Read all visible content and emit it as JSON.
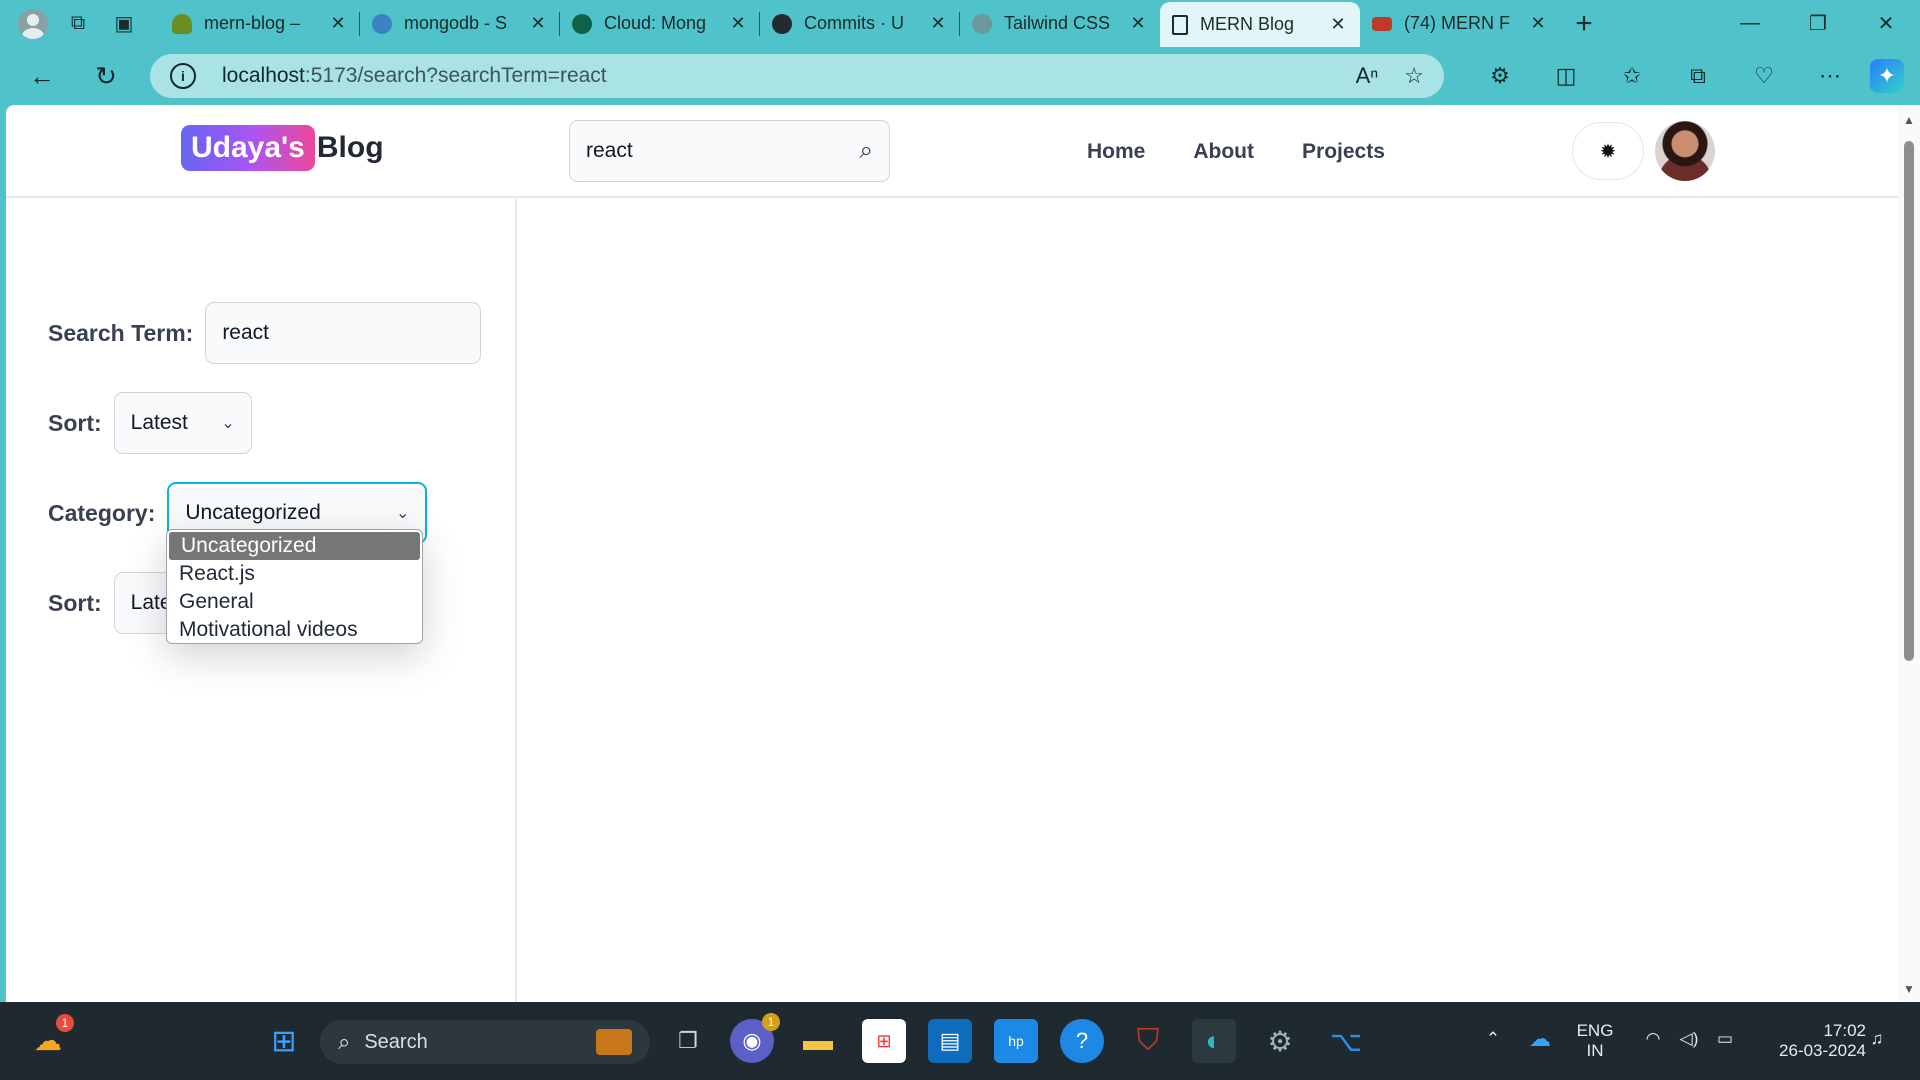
{
  "browser": {
    "tabs": [
      {
        "label": "mern-blog –",
        "favicon_color": "#6b8e23"
      },
      {
        "label": "mongodb - S",
        "favicon_color": "#3b82c4"
      },
      {
        "label": "Cloud: Mong",
        "favicon_color": "#116149"
      },
      {
        "label": "Commits · U",
        "favicon_color": "#24292f"
      },
      {
        "label": "Tailwind CSS",
        "favicon_color": "#6a9a9d"
      },
      {
        "label": "MERN Blog",
        "favicon_color": "#ffffff"
      },
      {
        "label": "(74) MERN F",
        "favicon_color": "#ff0000"
      }
    ],
    "url_host": "localhost",
    "url_rest": ":5173/search?searchTerm=react"
  },
  "header": {
    "logo_badge": "Udaya's",
    "logo_rest": "Blog",
    "search_value": "react",
    "nav": [
      "Home",
      "About",
      "Projects"
    ]
  },
  "sidebar": {
    "search_term_label": "Search Term:",
    "search_term_value": "react",
    "sort_label": "Sort:",
    "sort_value": "Latest",
    "category_label": "Category:",
    "category_value": "Uncategorized",
    "category_options": [
      "Uncategorized",
      "React.js",
      "General",
      "Motivational videos"
    ],
    "sort2_label": "Sort:",
    "sort2_value": "Late"
  },
  "taskbar": {
    "search_placeholder": "Search",
    "lang_top": "ENG",
    "lang_bottom": "IN",
    "time": "17:02",
    "date": "26-03-2024",
    "weather_badge": "1",
    "teams_badge": "1"
  },
  "colors": {
    "accent": "#06b6d4",
    "browser_chrome": "#4fc3c9",
    "logo_gradient_start": "#6366f1",
    "logo_gradient_end": "#ec4899"
  }
}
